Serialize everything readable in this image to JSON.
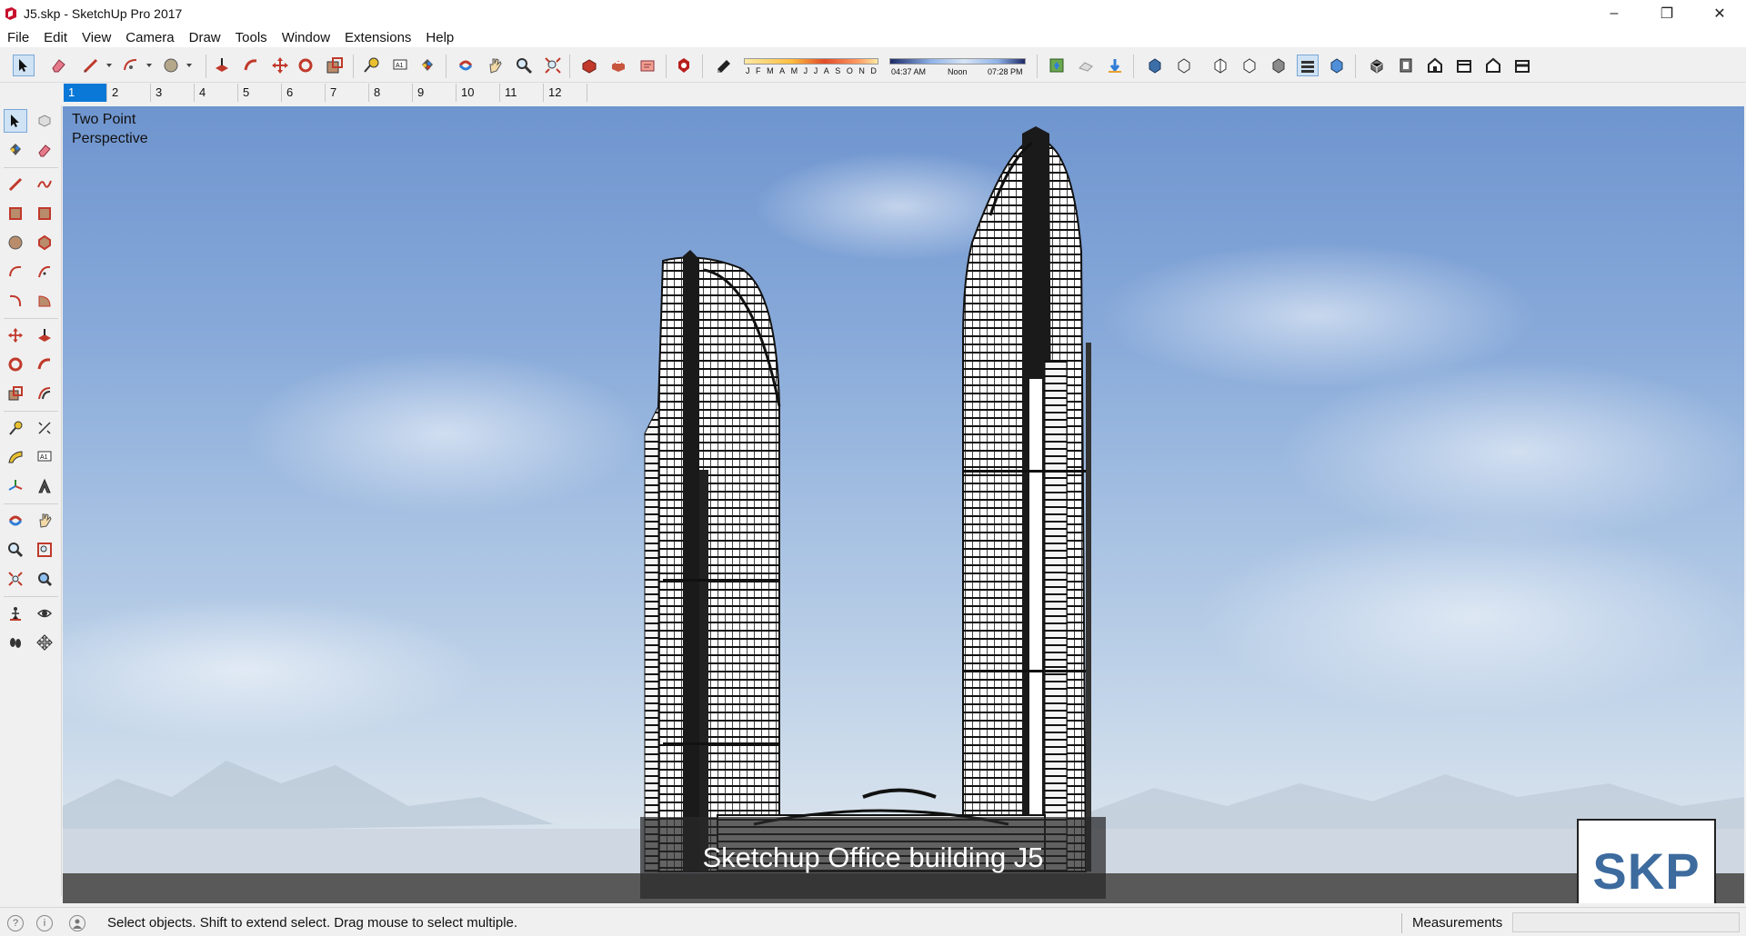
{
  "window": {
    "title": "J5.skp - SketchUp Pro 2017",
    "minimize": "–",
    "maximize": "❐",
    "close": "✕"
  },
  "menu": [
    "File",
    "Edit",
    "View",
    "Camera",
    "Draw",
    "Tools",
    "Window",
    "Extensions",
    "Help"
  ],
  "shadow_settings": {
    "months": [
      "J",
      "F",
      "M",
      "A",
      "M",
      "J",
      "J",
      "A",
      "S",
      "O",
      "N",
      "D"
    ],
    "time_labels": [
      "04:37 AM",
      "Noon",
      "07:28 PM"
    ]
  },
  "scenes": [
    "1",
    "2",
    "3",
    "4",
    "5",
    "6",
    "7",
    "8",
    "9",
    "10",
    "11",
    "12"
  ],
  "active_scene": "1",
  "viewport": {
    "camera_mode": "Two Point Perspective",
    "caption": "Sketchup Office building J5",
    "badge": "SKP"
  },
  "statusbar": {
    "hint": "Select objects. Shift to extend select. Drag mouse to select multiple.",
    "measurements_label": "Measurements",
    "measurements_value": ""
  }
}
